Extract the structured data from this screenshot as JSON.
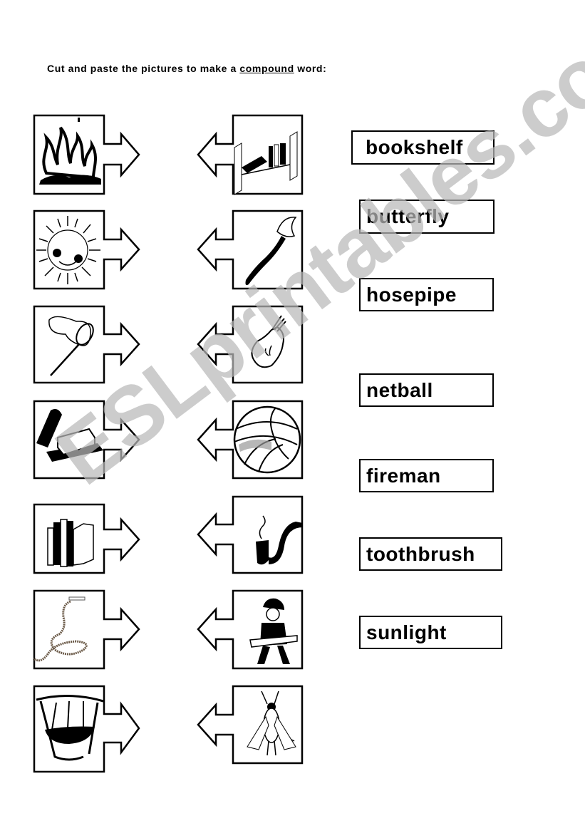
{
  "instruction": {
    "before": "Cut and paste the pictures to make a ",
    "emphasis": "compound",
    "after": " word:"
  },
  "left_cards": [
    {
      "picture": "fire-icon",
      "label": "fire"
    },
    {
      "picture": "sun-icon",
      "label": "sun"
    },
    {
      "picture": "butterfly-net-icon",
      "label": "net"
    },
    {
      "picture": "butter-icon",
      "label": "butter"
    },
    {
      "picture": "books-icon",
      "label": "book"
    },
    {
      "picture": "hose-icon",
      "label": "hose"
    },
    {
      "picture": "mouth-teeth-icon",
      "label": "tooth"
    }
  ],
  "right_cards": [
    {
      "picture": "bookshelf-shelf-icon",
      "label": "shelf"
    },
    {
      "picture": "toothbrush-icon",
      "label": "brush"
    },
    {
      "picture": "light-bulb-icon",
      "label": "light"
    },
    {
      "picture": "ball-icon",
      "label": "ball"
    },
    {
      "picture": "pipe-icon",
      "label": "pipe"
    },
    {
      "picture": "fireman-icon",
      "label": "man"
    },
    {
      "picture": "fly-icon",
      "label": "fly"
    }
  ],
  "words": [
    "bookshelf",
    "butterfly",
    "hosepipe",
    "netball",
    "fireman",
    "toothbrush",
    "sunlight"
  ],
  "watermark": "ESLprintables.com"
}
